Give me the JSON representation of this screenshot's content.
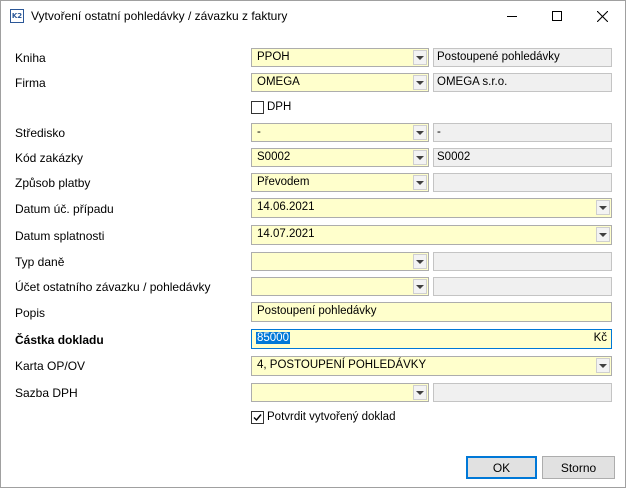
{
  "window": {
    "title": "Vytvoření ostatní pohledávky / závazku z faktury",
    "app_icon_text": "K2",
    "minimize": "—",
    "maximize": "☐",
    "close": "✕"
  },
  "fields": {
    "kniha": {
      "label": "Kniha",
      "value": "PPOH",
      "description": "Postoupené pohledávky"
    },
    "firma": {
      "label": "Firma",
      "value": "OMEGA",
      "description": "OMEGA s.r.o."
    },
    "dph_checkbox": {
      "label": "DPH",
      "checked": false
    },
    "stredisko": {
      "label": "Středisko",
      "value": "-",
      "description": "-"
    },
    "kod_zakazky": {
      "label": "Kód zakázky",
      "value": "S0002",
      "description": "S0002"
    },
    "zpusob_platby": {
      "label": "Způsob platby",
      "value": "Převodem",
      "description": ""
    },
    "datum_uc_pripadu": {
      "label": "Datum úč. případu",
      "value": "14.06.2021"
    },
    "datum_splatnosti": {
      "label": "Datum splatnosti",
      "value": "14.07.2021"
    },
    "typ_dane": {
      "label": "Typ daně",
      "value": "",
      "description": ""
    },
    "ucet": {
      "label": "Účet ostatního závazku / pohledávky",
      "value": "",
      "description": ""
    },
    "popis": {
      "label": "Popis",
      "value": "Postoupení pohledávky"
    },
    "castka": {
      "label": "Částka dokladu",
      "value": "85000",
      "currency": "Kč"
    },
    "karta": {
      "label": "Karta OP/OV",
      "value": "4, POSTOUPENÍ POHLEDÁVKY"
    },
    "sazba_dph": {
      "label": "Sazba DPH",
      "value": "",
      "description": ""
    },
    "potvrdit": {
      "label": "Potvrdit vytvořený doklad",
      "checked": true
    }
  },
  "buttons": {
    "ok": "OK",
    "cancel": "Storno"
  },
  "colors": {
    "input_bg": "#ffffcc",
    "readonly_bg": "#f0f0f0",
    "accent": "#0078d7"
  }
}
